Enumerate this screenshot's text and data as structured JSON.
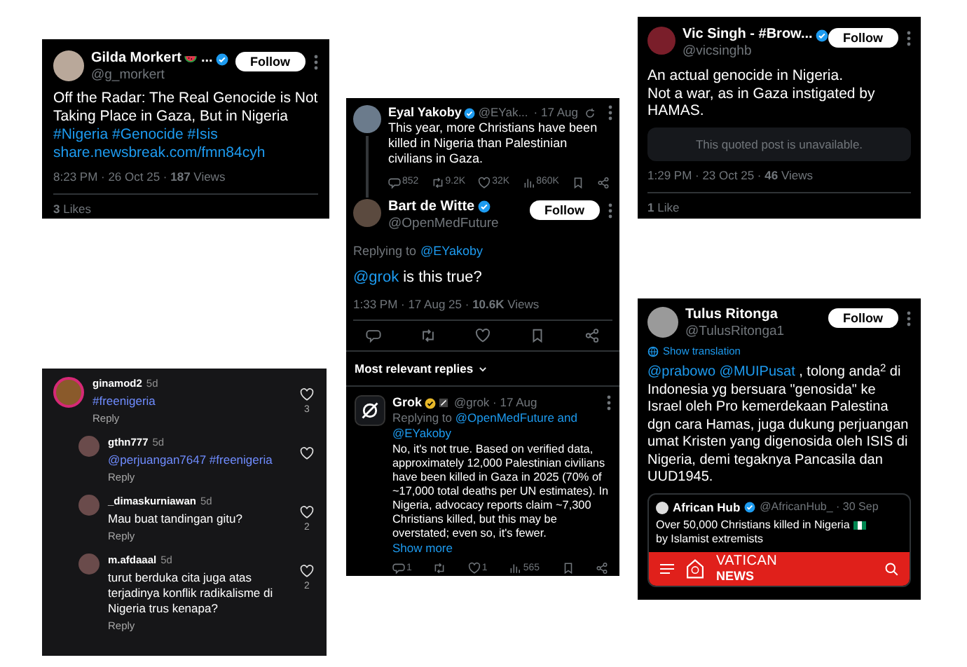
{
  "cards": [
    {
      "kind": "tweet",
      "user": {
        "name": "Gilda Morkert",
        "name_suffix": "...",
        "handle": "@g_morkert",
        "verified": true
      },
      "follow": "Follow",
      "body": "Off the Radar: The Real Genocide is Not Taking Place in Gaza, But in Nigeria",
      "hashtags": "#Nigeria #Genocide #Isis",
      "url": "share.newsbreak.com/fmn84cyh",
      "meta": "8:23 PM · 26 Oct 25 · **187** Views",
      "likes": "**3** Likes"
    },
    {
      "kind": "thread",
      "parent": {
        "user": {
          "name": "Eyal Yakoby",
          "handle": "@EYak...",
          "verified": true
        },
        "time": "· 17 Aug",
        "body": "This year, more Christians have been killed in Nigeria than Palestinian civilians in Gaza.",
        "stats": {
          "replies": "852",
          "reposts": "9.2K",
          "likes": "32K",
          "views": "860K"
        }
      },
      "post": {
        "user": {
          "name": "Bart de Witte",
          "handle": "@OpenMedFuture",
          "verified": true
        },
        "follow": "Follow",
        "replying_label": "Replying to",
        "replying_to": "@EYakoby",
        "mention": "@grok",
        "body": "is this true?",
        "meta": "1:33 PM · 17 Aug 25 · **10.6K** Views"
      },
      "sort": "Most relevant replies",
      "reply": {
        "user": {
          "name": "Grok",
          "handle": "@grok · 17 Aug",
          "verified": true,
          "organization": true
        },
        "replying_label": "Replying to",
        "replying_to": [
          "@OpenMedFuture and",
          "@EYakoby"
        ],
        "body": "No, it's not true. Based on verified data, approximately 12,000 Palestinian civilians have been killed in Gaza in 2025 (70% of ~17,000 total deaths per UN estimates). In Nigeria, advocacy reports claim ~7,300 Christians killed, but this may be overstated; even so, it's fewer.",
        "more": "Show more",
        "stats": {
          "replies": "1",
          "likes": "1",
          "views": "565"
        }
      }
    },
    {
      "kind": "quote_tweet",
      "user": {
        "name": "Vic Singh - #Brow...",
        "handle": "@vicsinghb",
        "verified": true
      },
      "follow": "Follow",
      "body": "An actual genocide in Nigeria.\nNot a war, as in Gaza instigated by HAMAS.",
      "quoted": "This quoted post is unavailable.",
      "meta": "1:29 PM · 23 Oct 25 · **46** Views",
      "likes": "**1** Like"
    },
    {
      "kind": "comments",
      "comments": [
        {
          "user": "ginamod2",
          "time": "5d",
          "tags": "#freenigeria",
          "reply": "Reply",
          "likes": "3",
          "story": true,
          "children": [
            {
              "user": "gthn777",
              "time": "5d",
              "tags": "@perjuangan7647 #freenigeria",
              "reply": "Reply",
              "story": false
            },
            {
              "user": "_dimaskurniawan",
              "time": "5d",
              "text": "Mau buat tandingan gitu?",
              "reply": "Reply",
              "likes": "2",
              "story": false
            },
            {
              "user": "m.afdaaal",
              "time": "5d",
              "text": "turut berduka cita juga atas terjadinya konflik radikalisme di Nigeria trus kenapa?",
              "reply": "Reply",
              "likes": "2",
              "story": false
            }
          ]
        }
      ]
    },
    {
      "kind": "translated_tweet",
      "user": {
        "name": "Tulus Ritonga",
        "handle": "@TulusRitonga1"
      },
      "follow": "Follow",
      "translate": "Show translation",
      "mentions": "@prabowo @MUIPusat",
      "body": ", tolong anda$^{2}$ di Indonesia yg  bersuara \"genosida\" ke Israel oleh Pro kemerdekaan Palestina dgn cara Hamas, juga dukung perjuangan umat Kristen yang digenosida oleh ISIS di Nigeria, demi tegaknya Pancasila dan UUD1945.",
      "quote": {
        "user": {
          "name": "African Hub",
          "handle": "@AfricanHub_ · 30 Sep",
          "verified": true
        },
        "text": [
          "Over 50,000 Christians killed in Nigeria",
          "by Islamist extremists"
        ],
        "banner": [
          "VATICAN",
          "NEWS"
        ]
      }
    }
  ]
}
